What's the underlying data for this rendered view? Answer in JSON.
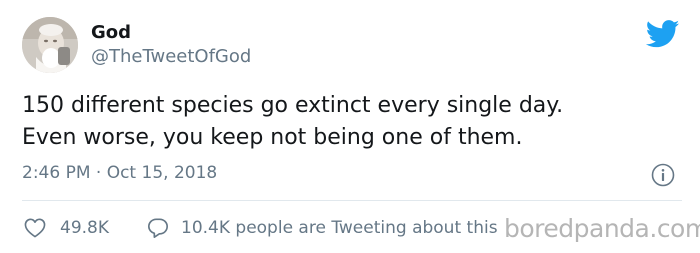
{
  "author": {
    "name": "God",
    "handle": "@TheTweetOfGod",
    "avatar_icon": "avatar-photo"
  },
  "brand": {
    "icon": "twitter-bird-icon",
    "color": "#1da1f2"
  },
  "tweet": {
    "lines": [
      "150 different species go extinct every single day.",
      "Even worse, you keep not being one of them."
    ],
    "timestamp": "2:46 PM · Oct 15, 2018"
  },
  "actions": {
    "likes": {
      "icon": "heart-icon",
      "count": "49.8K"
    },
    "conversation": {
      "icon": "speech-bubble-icon",
      "label": "10.4K people are Tweeting about this"
    },
    "info_icon": "info-icon"
  },
  "watermark": "boredpanda.com",
  "colors": {
    "text": "#14171a",
    "secondary": "#657786",
    "divider": "#e1e8ed"
  }
}
